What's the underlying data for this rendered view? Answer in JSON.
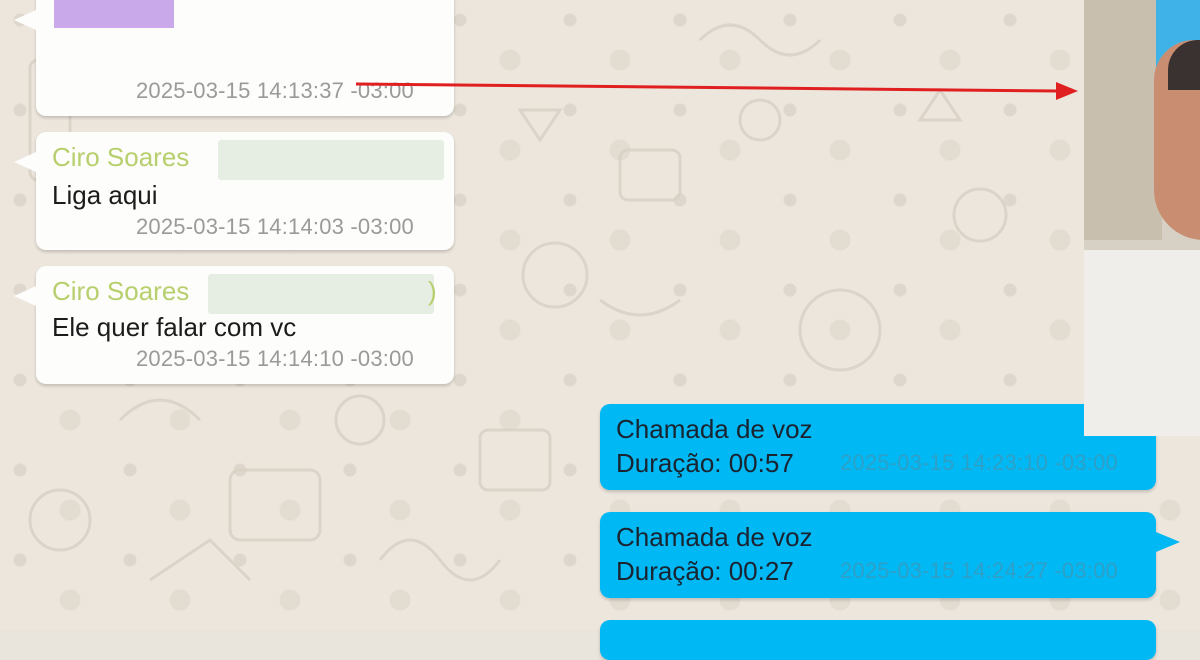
{
  "messages": [
    {
      "direction": "incoming",
      "type": "image",
      "timestamp": "2025-03-15 14:13:37 -03:00"
    },
    {
      "direction": "incoming",
      "sender": "Ciro Soares",
      "text": "Liga aqui",
      "timestamp": "2025-03-15 14:14:03 -03:00"
    },
    {
      "direction": "incoming",
      "sender": "Ciro Soares",
      "sender_trailing": ")",
      "text": "Ele quer falar com vc",
      "timestamp": "2025-03-15 14:14:10 -03:00"
    },
    {
      "direction": "outgoing",
      "title": "Chamada de voz",
      "duration": "Duração: 00:57",
      "timestamp": "2025-03-15 14:23:10 -03:00"
    },
    {
      "direction": "outgoing",
      "title": "Chamada de voz",
      "duration": "Duração: 00:27",
      "timestamp": "2025-03-15 14:24:27 -03:00"
    }
  ],
  "colors": {
    "incoming_bubble": "#fdfdfb",
    "outgoing_bubble": "#00b8f3",
    "sender_name": "#b7cf6c",
    "arrow": "#e02020",
    "image_thumbnail": "#caa9ea"
  },
  "icons": {
    "arrow": "arrow-right-icon",
    "photo": "profile-photo"
  }
}
